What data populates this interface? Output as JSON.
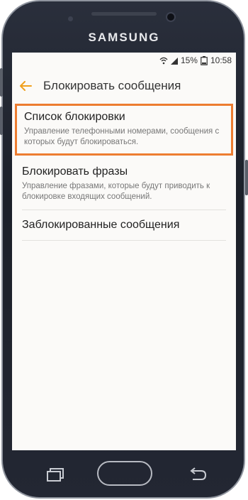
{
  "device": {
    "brand": "SAMSUNG"
  },
  "status_bar": {
    "battery": "15%",
    "time": "10:58"
  },
  "header": {
    "title": "Блокировать сообщения"
  },
  "menu": [
    {
      "label": "Список блокировки",
      "description": "Управление телефонными номерами, сообщения с которых будут блокироваться.",
      "highlighted": true
    },
    {
      "label": "Блокировать фразы",
      "description": "Управление фразами, которые будут приводить к блокировке входящих сообщений."
    },
    {
      "label": "Заблокированные сообщения"
    }
  ],
  "colors": {
    "accent": "#f0a01e",
    "highlight_border": "#ed7d31",
    "screen_bg": "#fbfaf8"
  },
  "icons": [
    "back-arrow-icon",
    "wifi-icon",
    "signal-icon",
    "battery-icon",
    "recents-icon",
    "home-button",
    "back-icon"
  ]
}
